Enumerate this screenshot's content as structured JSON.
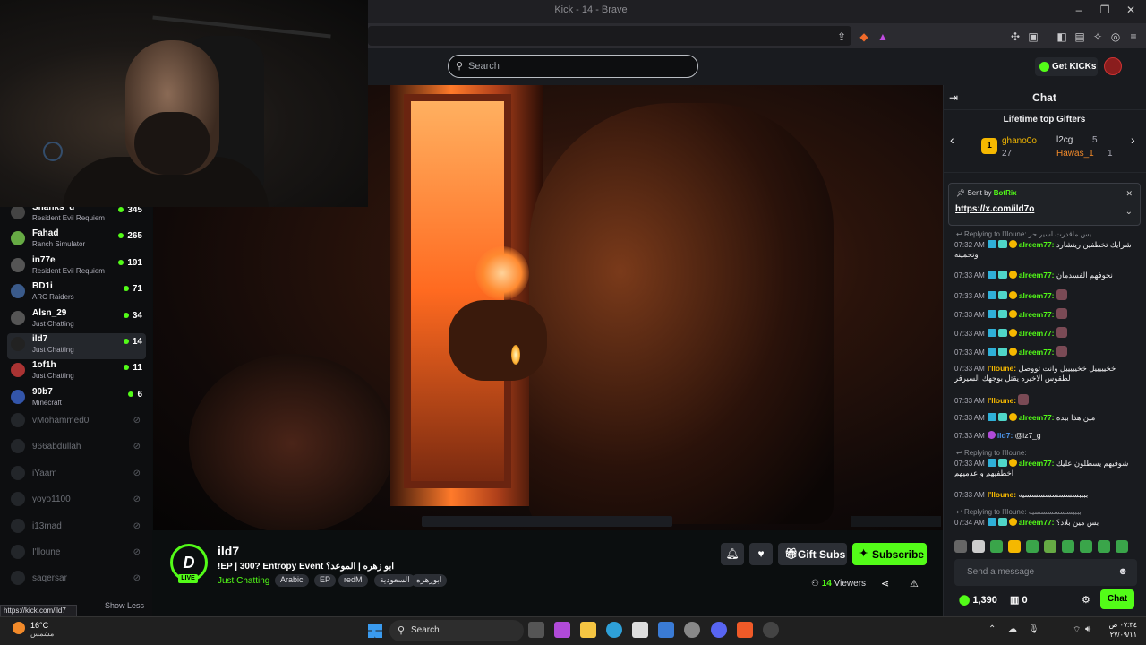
{
  "window": {
    "title": "Kick - 14 - Brave"
  },
  "header": {
    "search_placeholder": "Search",
    "get_kicks": "Get KICKs"
  },
  "sidebar": {
    "live": [
      {
        "name": "Shanks_u",
        "game": "Resident Evil Requiem",
        "viewers": "345"
      },
      {
        "name": "Fahad",
        "game": "Ranch Simulator",
        "viewers": "265"
      },
      {
        "name": "in77e",
        "game": "Resident Evil Requiem",
        "viewers": "191"
      },
      {
        "name": "BD1i",
        "game": "ARC Raiders",
        "viewers": "71"
      },
      {
        "name": "Alsn_29",
        "game": "Just Chatting",
        "viewers": "34"
      },
      {
        "name": "ild7",
        "game": "Just Chatting",
        "viewers": "14"
      },
      {
        "name": "1of1h",
        "game": "Just Chatting",
        "viewers": "11"
      },
      {
        "name": "90b7",
        "game": "Minecraft",
        "viewers": "6"
      }
    ],
    "offline": [
      "vMohammed0",
      "966abdullah",
      "iYaam",
      "yoyo1100",
      "i13mad",
      "I'lloune",
      "saqersar"
    ],
    "show_less": "Show Less",
    "status_url": "https://kick.com/ild7"
  },
  "stream": {
    "channel": "ild7",
    "live_badge": "LIVE",
    "title": "!EP | 300? Entropy Event ابو زهره | الموعد؟",
    "category": "Just Chatting",
    "tags": [
      "Arabic",
      "EP",
      "redM",
      "السعودية",
      "ابوزهره"
    ],
    "gift_subs": "Gift Subs",
    "subscribe": "Subscribe",
    "viewers_count": "14",
    "viewers_label": "Viewers"
  },
  "chat": {
    "title": "Chat",
    "gifters_title": "Lifetime top Gifters",
    "gifters": [
      {
        "rank": "1",
        "name": "ghano0o",
        "count": "27"
      },
      {
        "rank": "",
        "name": "l2cg",
        "count": "5"
      },
      {
        "rank": "",
        "name": "Hawas_1",
        "count": "1"
      }
    ],
    "pinned": {
      "sent_by": "Sent by",
      "bot": "BotRix",
      "url": "https://x.com/ild7o"
    },
    "messages": [
      {
        "type": "reply",
        "text": "Replying to I'lloune: بس ماقدرت اسير حر"
      },
      {
        "time": "07:32 AM",
        "user": "alreem77:",
        "color": "#53fc18",
        "text": "شرايك تخطفين ريتشارد وتحمينه"
      },
      {
        "time": "07:33 AM",
        "user": "alreem77:",
        "color": "#53fc18",
        "text": "نخوفهم الفسدمان"
      },
      {
        "time": "07:33 AM",
        "user": "alreem77:",
        "color": "#53fc18",
        "text": ""
      },
      {
        "time": "07:33 AM",
        "user": "alreem77:",
        "color": "#53fc18",
        "text": ""
      },
      {
        "time": "07:33 AM",
        "user": "alreem77:",
        "color": "#53fc18",
        "text": ""
      },
      {
        "time": "07:33 AM",
        "user": "alreem77:",
        "color": "#53fc18",
        "text": ""
      },
      {
        "time": "07:33 AM",
        "user": "I'lloune:",
        "color": "#f5b800",
        "text": "خخيييييل خخيييييل وانت تووصل لطقوس الاخيره يقتل بوجهك السيرفر"
      },
      {
        "time": "07:33 AM",
        "user": "I'lloune:",
        "color": "#f5b800",
        "text": ""
      },
      {
        "time": "07:33 AM",
        "user": "alreem77:",
        "color": "#53fc18",
        "text": "مين هذا بيده"
      },
      {
        "time": "07:33 AM",
        "user": "ild7:",
        "color": "#4a90e2",
        "text": "@iz7_g"
      },
      {
        "type": "reply",
        "text": "Replying to I'lloune:"
      },
      {
        "time": "07:33 AM",
        "user": "alreem77:",
        "color": "#53fc18",
        "text": "شوفيهم يسطلون عليك اخطفيهم واعدميهم"
      },
      {
        "time": "07:33 AM",
        "user": "I'lloune:",
        "color": "#f5b800",
        "text": "ببببسسسسسسسسيه"
      },
      {
        "type": "reply",
        "text": "Replying to I'lloune: ببببسسسسسسيه"
      },
      {
        "time": "07:34 AM",
        "user": "alreem77:",
        "color": "#53fc18",
        "text": "بس مين بلاد؟"
      }
    ],
    "input_placeholder": "Send a message",
    "points": "1,390",
    "stash": "0",
    "send": "Chat"
  },
  "taskbar": {
    "temp": "16°C",
    "weather": "مشمس",
    "search": "Search",
    "time": "٠٧:٣٤ ص",
    "date": "٢٧/٠٩/١١"
  }
}
